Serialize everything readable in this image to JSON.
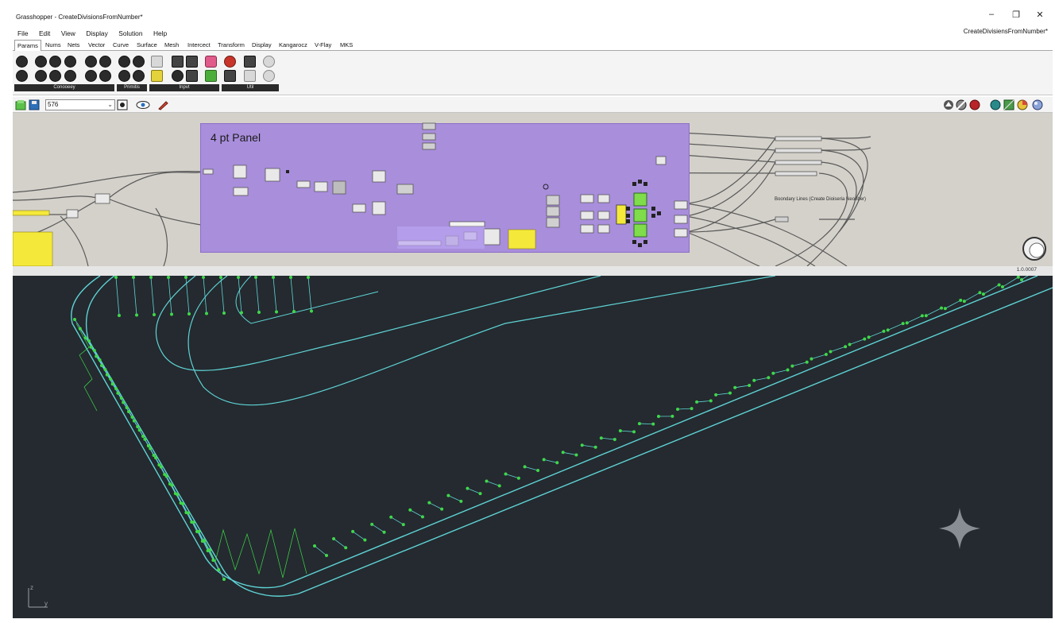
{
  "window": {
    "title": "Grasshopper - CreateDivisionsFromNumber*",
    "minimize": "–",
    "restore": "❐",
    "close": "✕"
  },
  "menu": {
    "items": [
      "File",
      "Edit",
      "View",
      "Display",
      "Solution",
      "Help"
    ],
    "document_name": "CreateDivisiensFromNumber*"
  },
  "tabs": [
    "Params",
    "Nums",
    "Nets",
    "Vector",
    "Curve",
    "Surface",
    "Mesh",
    "Intercect",
    "Transform",
    "Display",
    "Kangarocz",
    "V-Flay",
    "MKS"
  ],
  "active_tab": "Params",
  "ribbon": {
    "groups": [
      "Conooeey",
      "Primitis",
      "Inpvt",
      "Util"
    ]
  },
  "canvas_toolbar": {
    "zoom_value": "576"
  },
  "canvas": {
    "group_title": "4 pt Panel",
    "boundary_label": "Boondary Lines (Create Dioiseria Neoober)",
    "version": "1.0.0007"
  },
  "colors": {
    "group_fill": "#a98edc",
    "canvas_bg": "#d4d1ca",
    "viewport_bg": "#242a2f",
    "curve_cyan": "#5fd3d6",
    "point_green": "#3fd84a",
    "panel_yellow": "#f4e83a",
    "component_green": "#7fdc4a"
  },
  "icons": {
    "save": "save-icon",
    "open": "folder-icon",
    "eye": "eye-icon",
    "pen": "sketch-pen-icon",
    "sparkle": "sparkle-icon",
    "axes": "axis-gizmo-icon"
  }
}
